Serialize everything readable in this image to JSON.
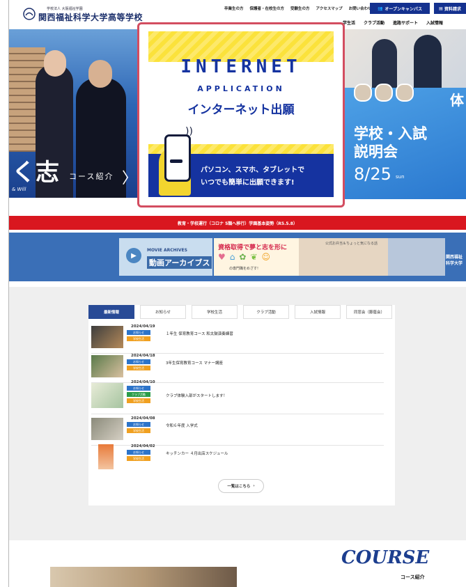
{
  "header": {
    "logo_small": "学校法人 大阪福祉学園",
    "logo_name": "関西福祉科学大学高等学校",
    "topnav": [
      "卒業生の方",
      "保護者・在校生の方",
      "受験生の方",
      "アクセスマップ",
      "お問い合わせ"
    ],
    "open_campus": "オープンキャンパス",
    "document_request": "資料請求",
    "mainnav": [
      "学生活",
      "クラブ活動",
      "進路サポート",
      "入試情報"
    ]
  },
  "hero_left": {
    "big_text": "く志",
    "course_link": "コース紹介",
    "chevron": "〉",
    "tagline": "& Will"
  },
  "featured": {
    "line1": "INTERNET",
    "line2": "APPLICATION",
    "line3": "インターネット出願",
    "body1": "パソコン、スマホ、タブレットで",
    "body2": "いつでも簡単に出願できます!"
  },
  "hero_right": {
    "tai": "体",
    "title1": "学校・入試",
    "title2": "説明会",
    "date": "8/25",
    "dow": "sun"
  },
  "notice": "教育・学校運行（コロナ 5類へ移行）学園基本姿勢（R5.5.8）",
  "banners": {
    "movie": "MOVIE ARCHIVES",
    "doga": "動画アーカイブス",
    "shikaku": "資格取得で夢と志を形に",
    "shikaku_sub": "の専門職をめざす!",
    "food": "公式お弁当＆ちょっと気になる話",
    "kansai": "関西福祉科学大学"
  },
  "news": {
    "tabs": [
      "最新情報",
      "お知らせ",
      "学校生活",
      "クラブ活動",
      "入試情報",
      "同窓会（藤蔭会）"
    ],
    "items": [
      {
        "date": "2024/04/19",
        "tags": [
          "お知らせ",
          "学校生活"
        ],
        "title": "１年生 保育教育コース 和太鼓演奏練習"
      },
      {
        "date": "2024/04/18",
        "tags": [
          "お知らせ",
          "学校生活"
        ],
        "title": "3年生保育教育コース マナー講座"
      },
      {
        "date": "2024/04/10",
        "tags": [
          "お知らせ",
          "クラブ活動",
          "学校生活"
        ],
        "title": "クラブ体験入部がスタートします！"
      },
      {
        "date": "2024/04/08",
        "tags": [
          "お知らせ",
          "学校生活"
        ],
        "title": "令和６年度 入学式"
      },
      {
        "date": "2024/04/02",
        "tags": [
          "お知らせ",
          "学校生活"
        ],
        "title": "キッチンカー ４月出店スケジュール"
      }
    ],
    "more": "一覧はこちら"
  },
  "course": {
    "en": "COURSE",
    "jp": "コース紹介"
  }
}
